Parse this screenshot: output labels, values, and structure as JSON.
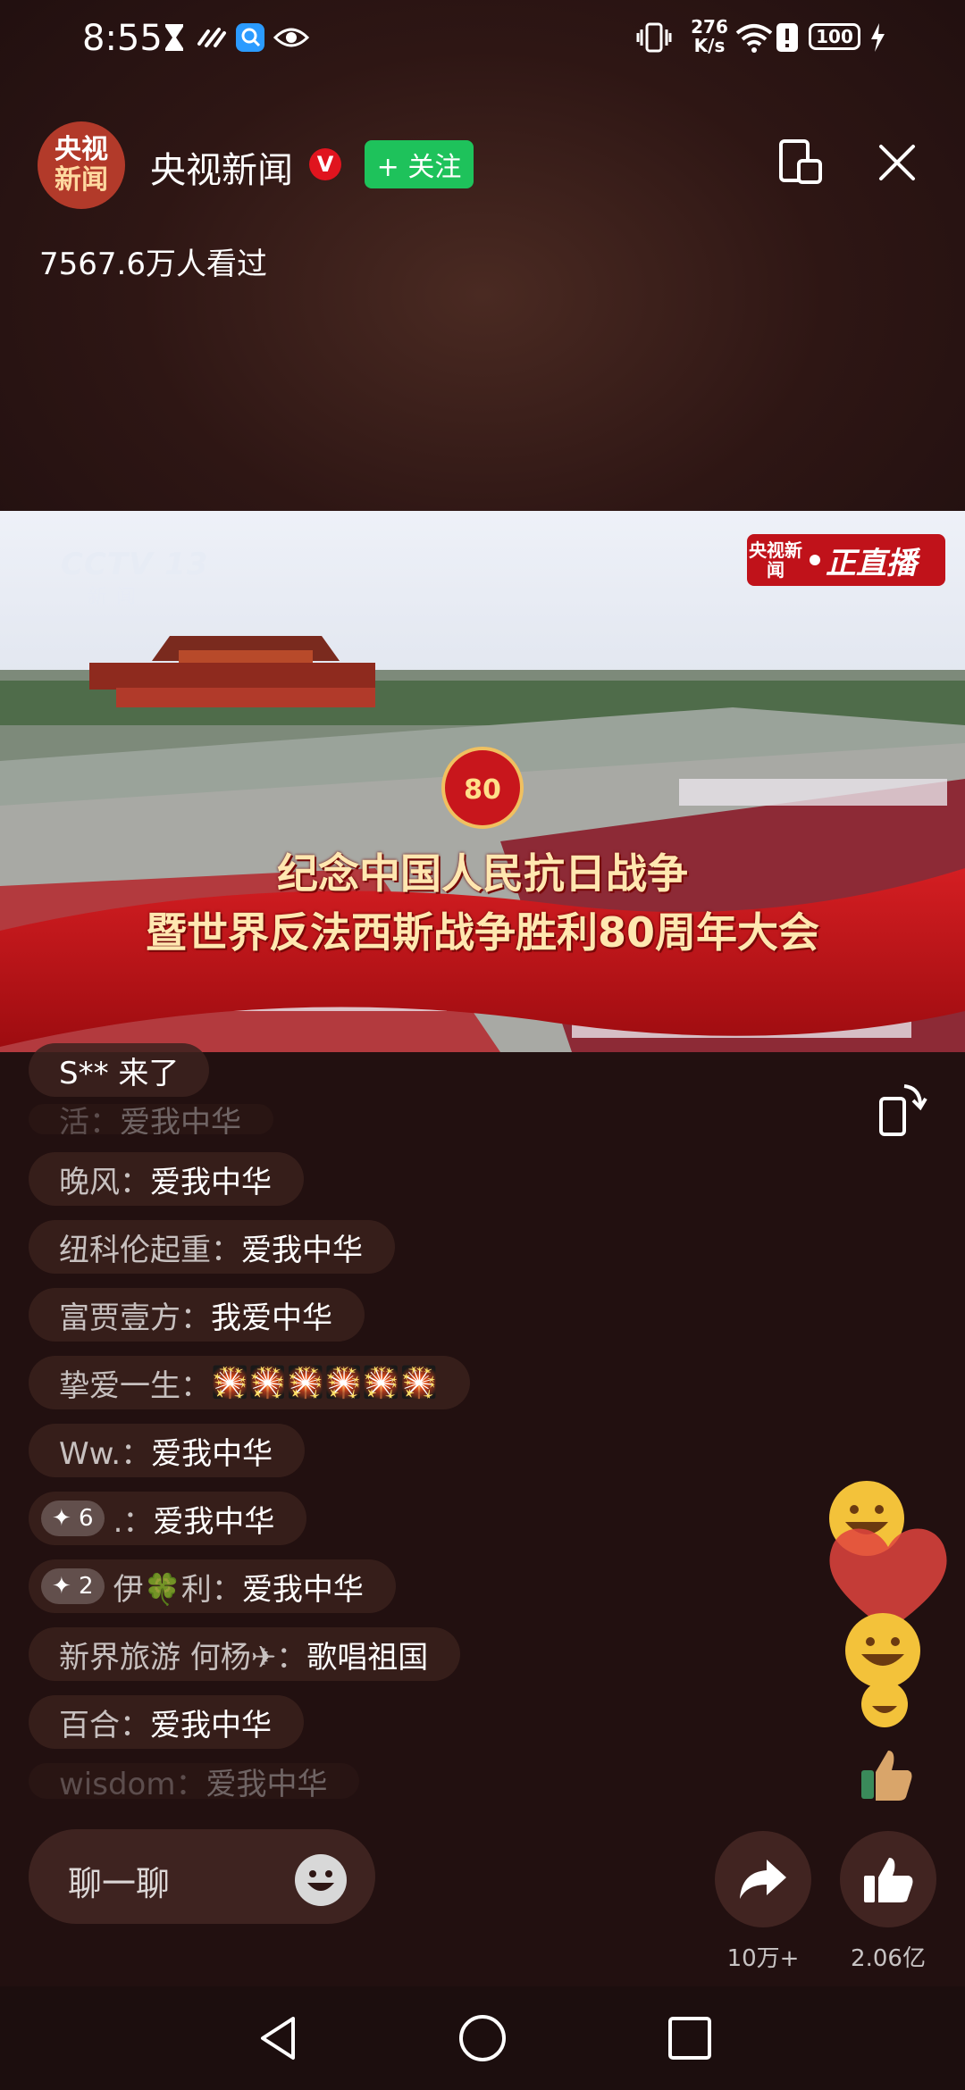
{
  "status_bar": {
    "time": "8:55",
    "net_speed_value": "276",
    "net_speed_unit": "K/s",
    "battery": "100",
    "icons": [
      "hourglass-icon",
      "link-icon",
      "search-app-icon",
      "eye-icon",
      "vibrate-icon",
      "wifi-icon",
      "alert-icon",
      "charging-icon"
    ]
  },
  "header": {
    "avatar_line1": "央视",
    "avatar_line2": "新闻",
    "channel_name": "央视新闻",
    "verified_mark": "V",
    "follow_label": "+ 关注",
    "views": "7567.6万人看过"
  },
  "video": {
    "channel_logo": "CCTV 13",
    "channel_logo_sub": "新闻",
    "live_badge_source": "央视新闻",
    "live_badge_label": "正直播",
    "banner_line1": "纪念中国人民抗日战争",
    "banner_line2": "暨世界反法西斯战争胜利80周年大会",
    "emblem_number": "80"
  },
  "comments": {
    "joined_notice": "S** 来了",
    "items": [
      {
        "user": "晚风：",
        "msg": "爱我中华"
      },
      {
        "user": "纽科伦起重：",
        "msg": "爱我中华"
      },
      {
        "user": "富贾壹方：",
        "msg": "我爱中华"
      },
      {
        "user": "挚爱一生：",
        "msg": "🎇🎇🎇🎇🎇🎇"
      },
      {
        "user": "Ww.：",
        "msg": "爱我中华"
      },
      {
        "badge": "✦ 6",
        "user": ".：",
        "msg": "爱我中华"
      },
      {
        "badge": "✦ 2",
        "user": "伊🍀利：",
        "msg": "爱我中华"
      },
      {
        "user": "新界旅游 何杨✈：",
        "msg": "歌唱祖国"
      },
      {
        "user": "百合：",
        "msg": "爱我中华"
      }
    ],
    "faded_top": {
      "user": "活：",
      "msg": "爱我中华"
    },
    "faded_bottom": {
      "user": "wisdom：",
      "msg": "爱我中华"
    }
  },
  "bottom_bar": {
    "chat_placeholder": "聊一聊",
    "share_count": "10万+",
    "like_count": "2.06亿"
  },
  "colors": {
    "follow_green": "#1ec25b",
    "verified_red": "#e0141e",
    "live_red": "#c0121a"
  }
}
